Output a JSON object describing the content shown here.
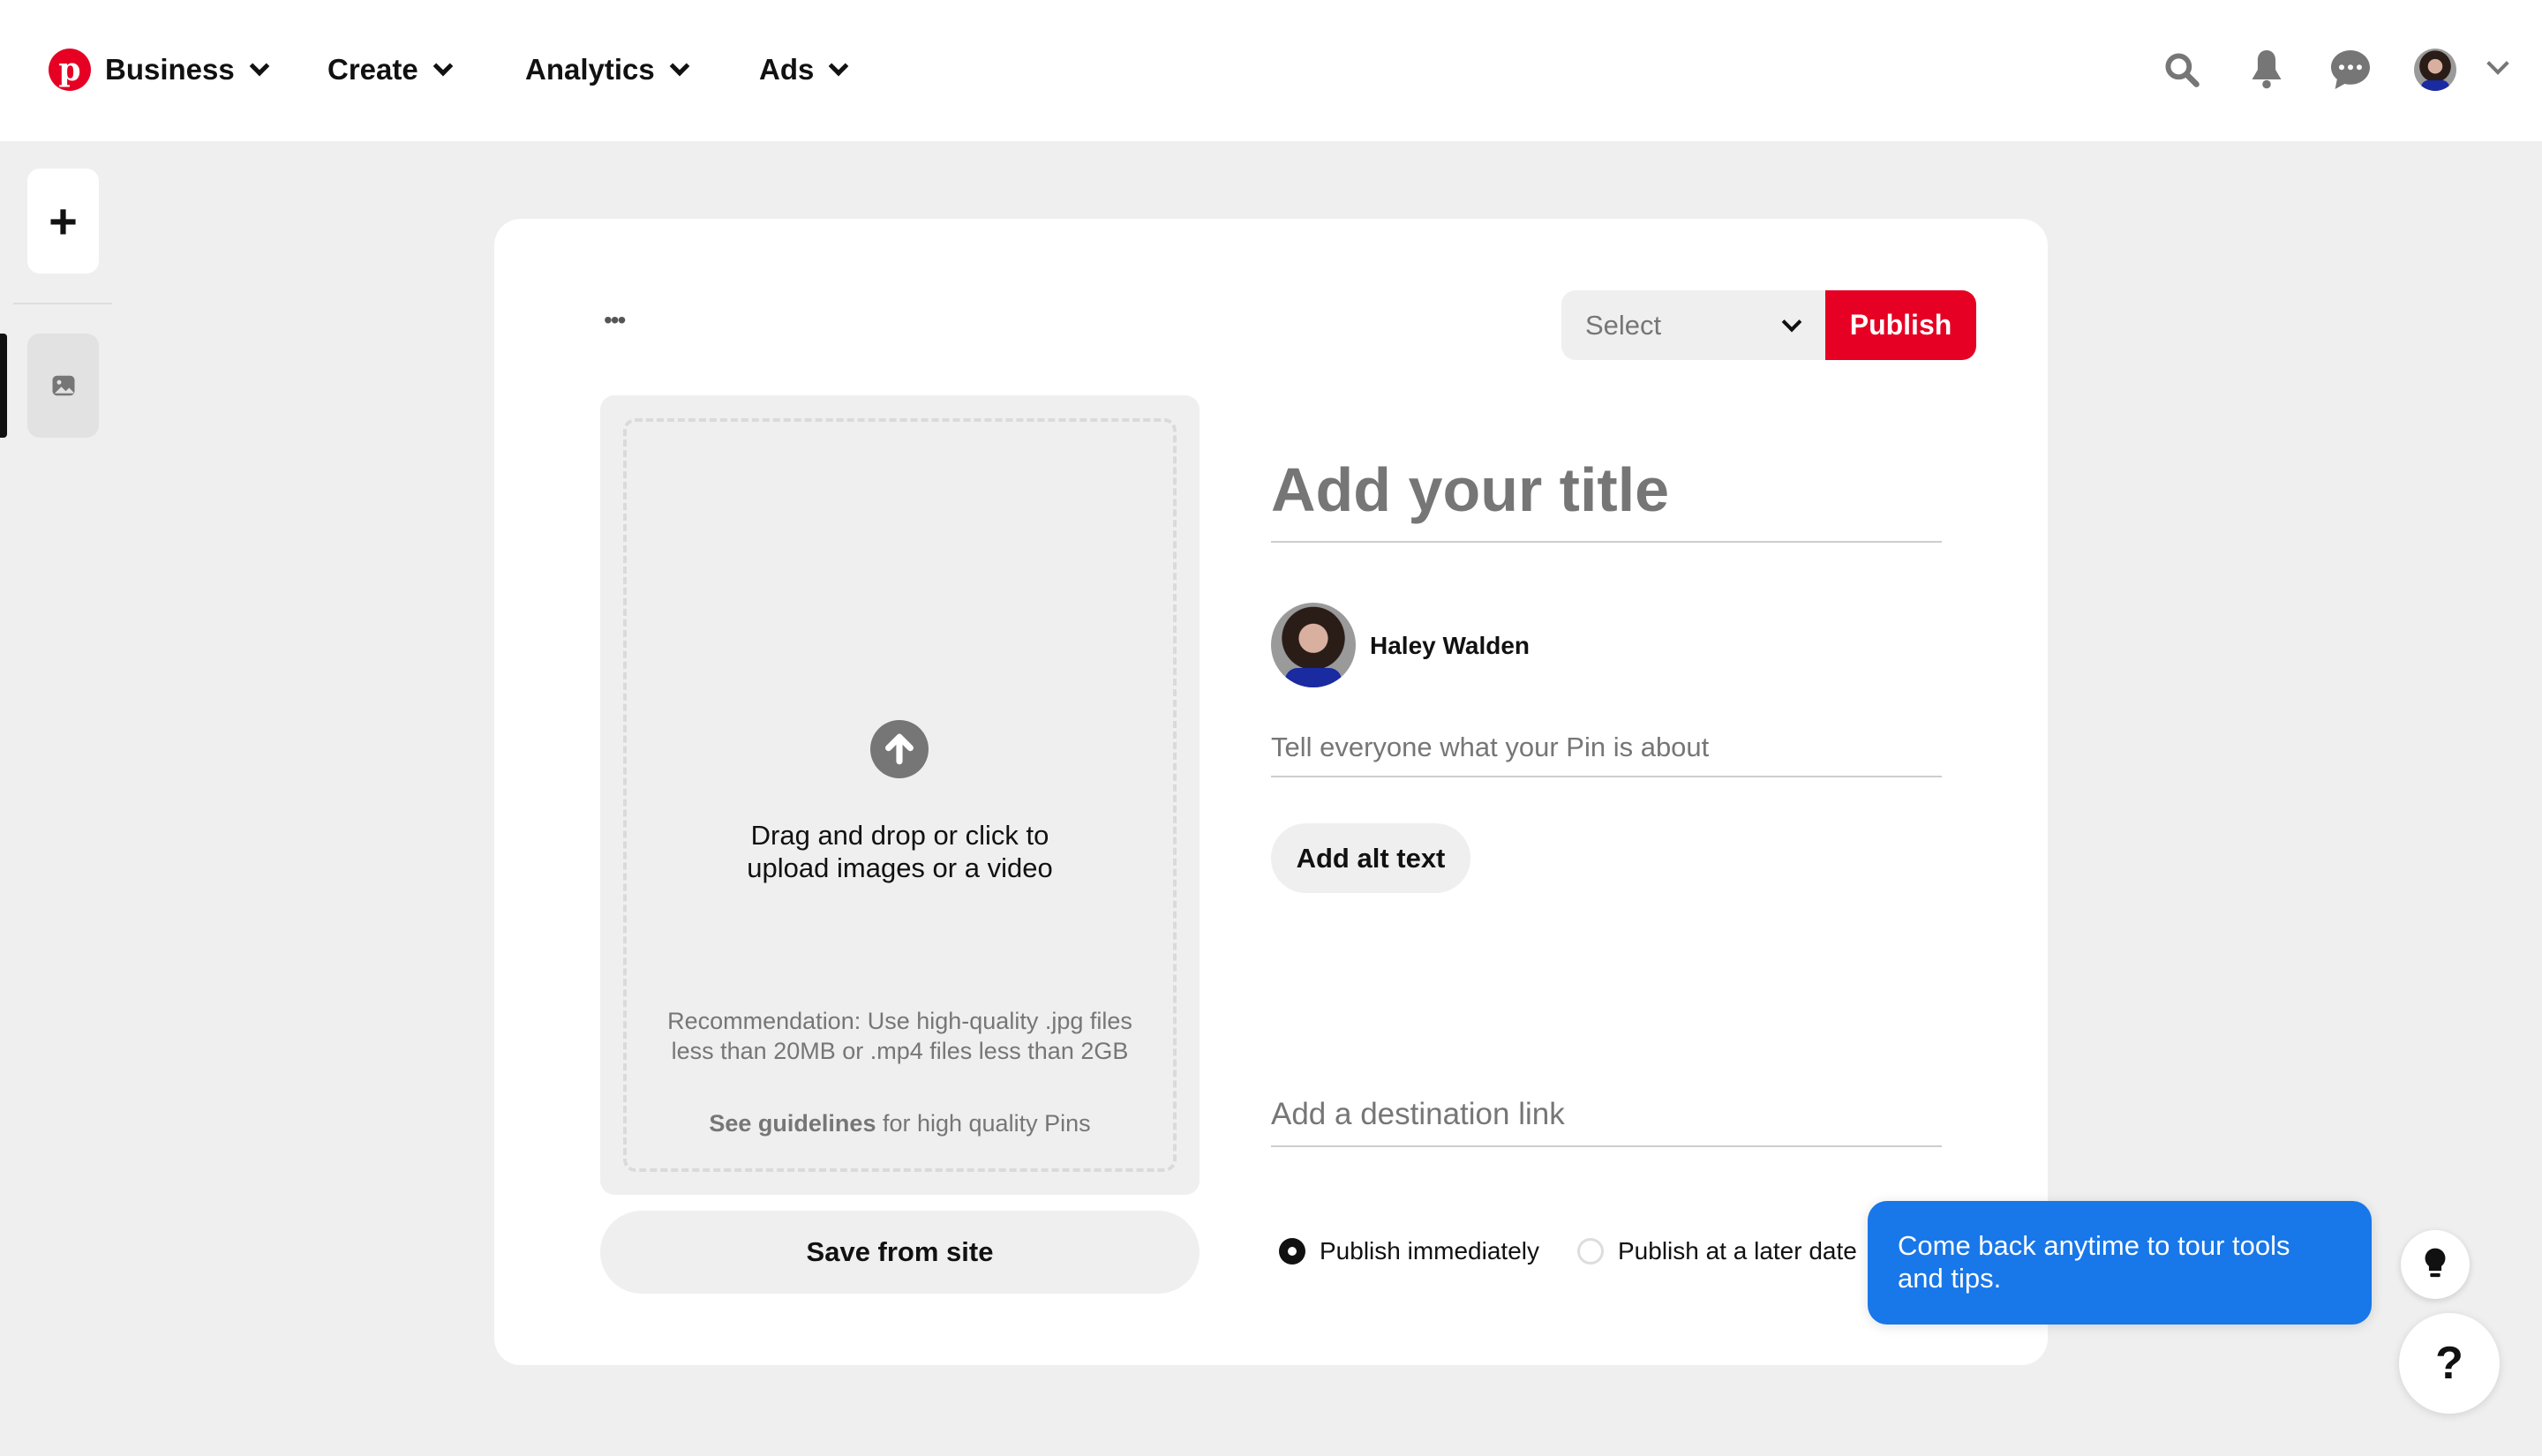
{
  "header": {
    "brand_color": "#e60023",
    "nav": [
      {
        "label": "Business"
      },
      {
        "label": "Create"
      },
      {
        "label": "Analytics"
      },
      {
        "label": "Ads"
      }
    ],
    "icons": [
      "search-icon",
      "bell-icon",
      "chat-icon",
      "avatar",
      "chevron-down-icon"
    ]
  },
  "sidebar": {
    "items": [
      {
        "icon": "plus-icon"
      },
      {
        "icon": "image-icon",
        "active": true
      }
    ]
  },
  "editor": {
    "more_label": "•••",
    "board_select": {
      "placeholder": "Select"
    },
    "publish_label": "Publish",
    "upload": {
      "main_text_1": "Drag and drop or click to",
      "main_text_2": "upload images or a video",
      "recommendation": "Recommendation: Use high-quality .jpg files less than 20MB or .mp4 files less than 2GB",
      "guidelines_link": "See guidelines",
      "guidelines_rest": " for high quality Pins"
    },
    "save_from_site_label": "Save from site",
    "title_placeholder": "Add your title",
    "user_name": "Haley Walden",
    "description_placeholder": "Tell everyone what your Pin is about",
    "alt_text_label": "Add alt text",
    "link_placeholder": "Add a destination link",
    "publish_options": [
      {
        "label": "Publish immediately",
        "selected": true
      },
      {
        "label": "Publish at a later date",
        "selected": false
      }
    ]
  },
  "tooltip": {
    "text": "Come back anytime to tour tools and tips.",
    "color": "#1877e9"
  },
  "help": {
    "label": "?"
  }
}
